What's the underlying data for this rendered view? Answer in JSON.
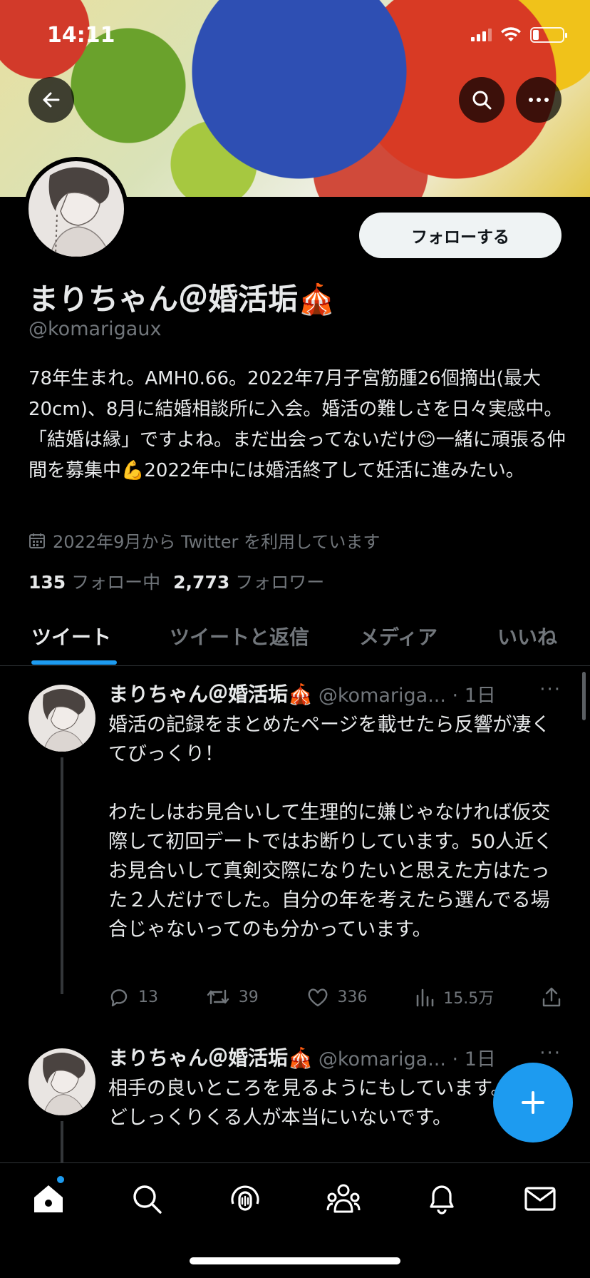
{
  "status_bar": {
    "time": "14:11",
    "battery_level": 0.2
  },
  "profile": {
    "follow_label": "フォローする",
    "name": "まりちゃん＠婚活垢🎪",
    "handle": "@komarigaux",
    "bio": "78年生まれ。AMH0.66。2022年7月子宮筋腫26個摘出(最大20cm)、8月に結婚相談所に入会。婚活の難しさを日々実感中。「結婚は縁」ですよね。まだ出会ってないだけ😊一緒に頑張る仲間を募集中💪2022年中には婚活終了して妊活に進みたい。",
    "joined": "2022年9月から Twitter を利用しています",
    "following_count": "135",
    "following_label": "フォロー中",
    "followers_count": "2,773",
    "followers_label": "フォロワー"
  },
  "tabs": [
    {
      "label": "ツイート",
      "active": true
    },
    {
      "label": "ツイートと返信",
      "active": false
    },
    {
      "label": "メディア",
      "active": false
    },
    {
      "label": "いいね",
      "active": false
    }
  ],
  "tweets": [
    {
      "name": "まりちゃん＠婚活垢🎪",
      "handle_time": "@komariga... · 1日",
      "more": "···",
      "body": "婚活の記録をまとめたページを載せたら反響が凄くてびっくり！\n\nわたしはお見合いして生理的に嫌じゃなければ仮交際して初回デートではお断りしています。50人近くお見合いして真剣交際になりたいと思えた方はたった２人だけでした。自分の年を考えたら選んでる場合じゃないってのも分かっています。",
      "replies": "13",
      "retweets": "39",
      "likes": "336",
      "views": "15.5万"
    },
    {
      "name": "まりちゃん＠婚活垢🎪",
      "handle_time": "@komariga... · 1日",
      "more": "···",
      "body": "相手の良いところを見るようにもしています。だけどしっくりくる人が本当にいないです。"
    }
  ],
  "colors": {
    "accent": "#1d9bf0",
    "background": "#000000",
    "text": "#e7e9ea",
    "muted": "#71767b"
  }
}
